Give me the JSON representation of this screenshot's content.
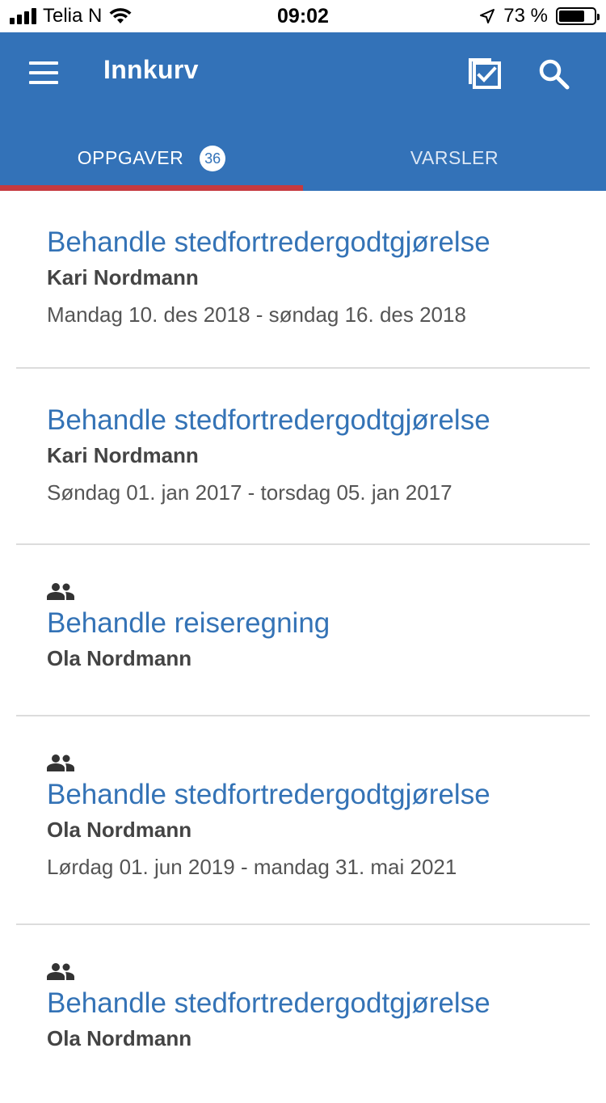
{
  "status_bar": {
    "carrier": "Telia N",
    "time": "09:02",
    "battery": "73 %",
    "battery_level": 0.73
  },
  "header": {
    "title": "Innkurv",
    "icons": [
      "menu-icon",
      "checklist-icon",
      "search-icon"
    ]
  },
  "tabs": [
    {
      "label": "OPPGAVER",
      "badge": "36",
      "active": true
    },
    {
      "label": "VARSLER",
      "active": false
    }
  ],
  "tasks": [
    {
      "title": "Behandle stedfortredergodtgjørelse",
      "person": "Kari Nordmann",
      "date": "Mandag 10. des 2018 - søndag 16. des 2018",
      "group": false
    },
    {
      "title": "Behandle stedfortredergodtgjørelse",
      "person": "Kari Nordmann",
      "date": "Søndag 01. jan 2017 - torsdag 05. jan 2017",
      "group": false
    },
    {
      "title": "Behandle reiseregning",
      "person": "Ola Nordmann",
      "date": "",
      "group": true
    },
    {
      "title": "Behandle stedfortredergodtgjørelse",
      "person": "Ola Nordmann",
      "date": "Lørdag 01. jun 2019 - mandag 31. mai 2021",
      "group": true
    },
    {
      "title": "Behandle stedfortredergodtgjørelse",
      "person": "Ola Nordmann",
      "date": "",
      "group": true
    }
  ],
  "colors": {
    "header_bg": "#3372b8",
    "tab_indicator": "#c63a3f",
    "title_text": "#3473b6"
  }
}
